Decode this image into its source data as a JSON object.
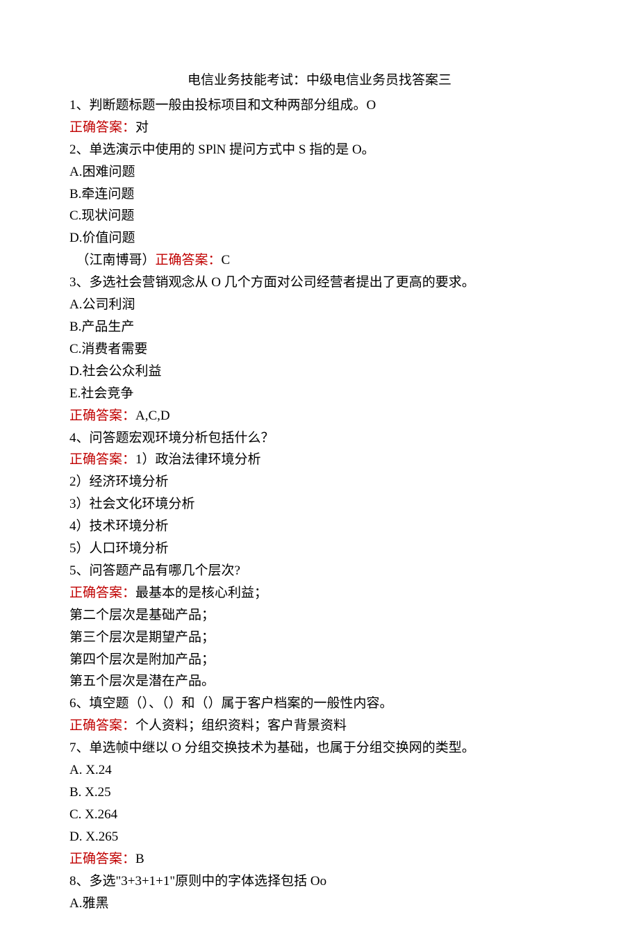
{
  "title": "电信业务技能考试：中级电信业务员找答案三",
  "q1": {
    "text": "1、判断题标题一般由投标项目和文种两部分组成。O",
    "answer_label": "正确答案：",
    "answer_value": "对"
  },
  "q2": {
    "text": "2、单选演示中使用的 SPlN 提问方式中 S 指的是 O。",
    "opt_a": "A.困难问题",
    "opt_b": "B.牵连问题",
    "opt_c": "C.现状问题",
    "opt_d": "D.价值问题",
    "source": "  （江南博哥）",
    "answer_label": "正确答案：",
    "answer_value": "C"
  },
  "q3": {
    "text": "3、多选社会营销观念从 O 几个方面对公司经营者提出了更高的要求。",
    "opt_a": "A.公司利润",
    "opt_b": "B.产品生产",
    "opt_c": "C.消费者需要",
    "opt_d": "D.社会公众利益",
    "opt_e": "E.社会竞争",
    "answer_label": "正确答案：",
    "answer_value": "A,C,D"
  },
  "q4": {
    "text": "4、问答题宏观环境分析包括什么？",
    "answer_label": "正确答案：",
    "answer_first": "1）政治法律环境分析",
    "line2": "2）经济环境分析",
    "line3": "3）社会文化环境分析",
    "line4": "4）技术环境分析",
    "line5": "5）人口环境分析"
  },
  "q5": {
    "text": "5、问答题产品有哪几个层次?",
    "answer_label": "正确答案：",
    "answer_first": "最基本的是核心利益；",
    "line2": "第二个层次是基础产品；",
    "line3": "第三个层次是期望产品；",
    "line4": "第四个层次是附加产品；",
    "line5": "第五个层次是潜在产品。"
  },
  "q6": {
    "text": "6、填空题（）、（）和（）属于客户档案的一般性内容。",
    "answer_label": "正确答案：",
    "answer_value": "个人资料；组织资料；客户背景资料"
  },
  "q7": {
    "text": "7、单选帧中继以 O 分组交换技术为基础，也属于分组交换网的类型。",
    "opt_a": "A. X.24",
    "opt_b": "B. X.25",
    "opt_c": "C. X.264",
    "opt_d": "D. X.265",
    "answer_label": "正确答案：",
    "answer_value": "B"
  },
  "q8": {
    "text": "8、多选\"3+3+1+1\"原则中的字体选择包括 Oo",
    "opt_a": "A.雅黑"
  }
}
